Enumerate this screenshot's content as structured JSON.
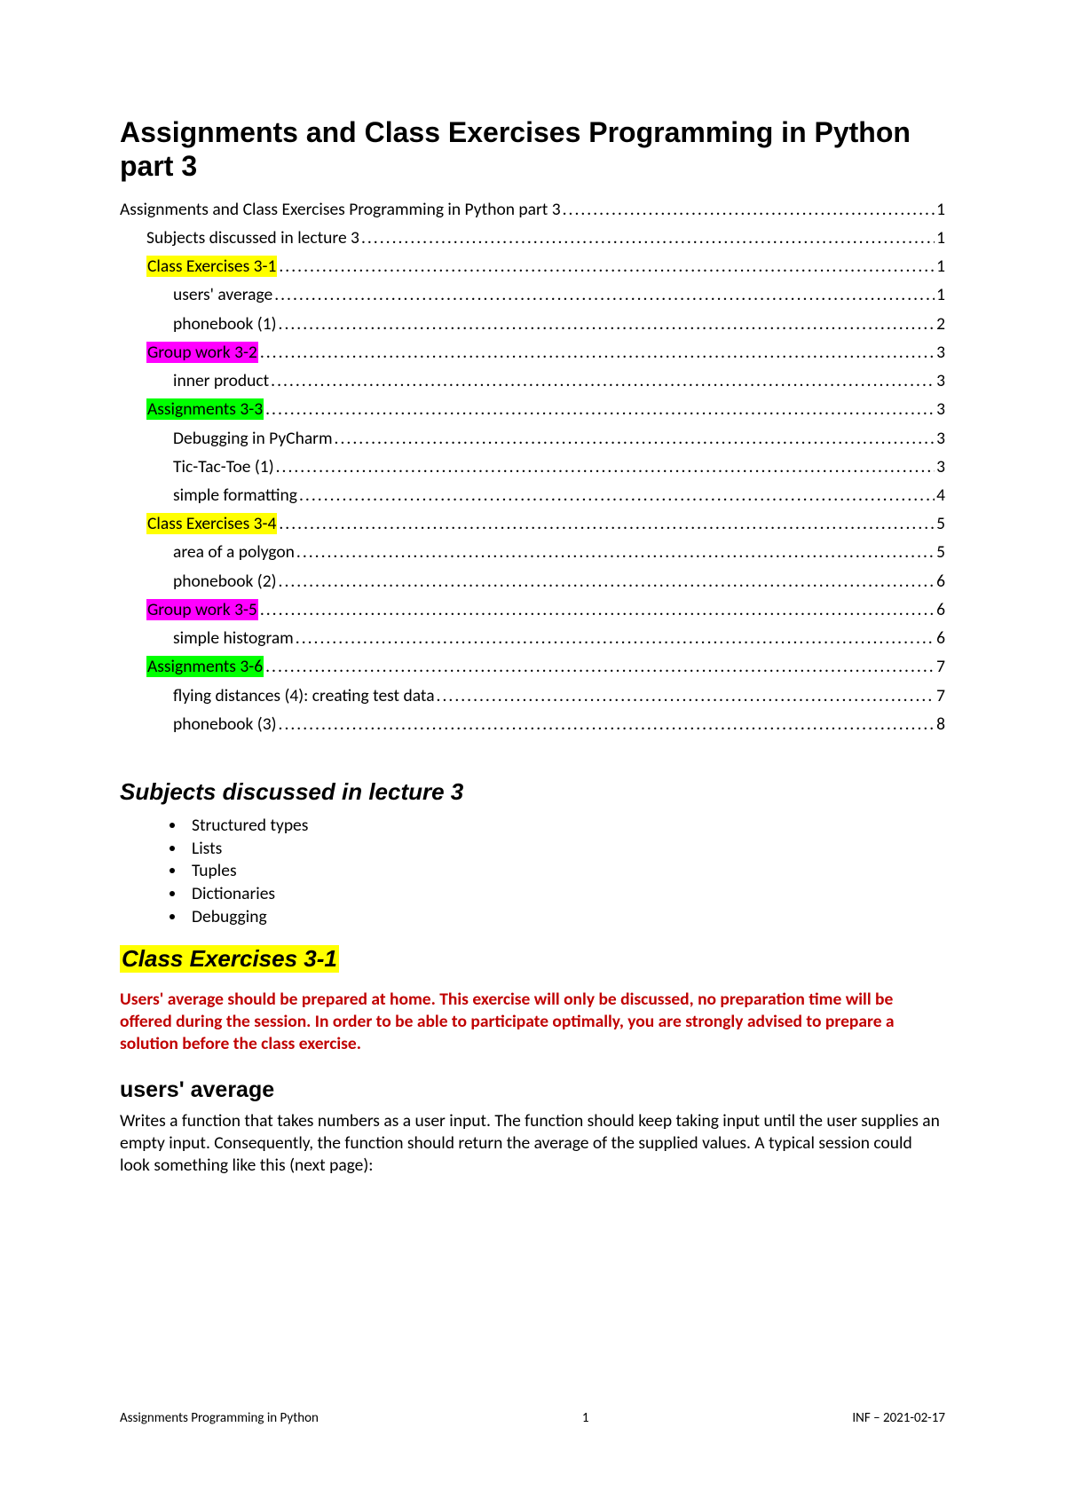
{
  "title": "Assignments and Class Exercises Programming in Python part 3",
  "toc": [
    {
      "label": "Assignments and Class Exercises Programming in Python part 3",
      "page": "1",
      "level": 0,
      "highlight": null
    },
    {
      "label": "Subjects discussed in lecture 3",
      "page": "1",
      "level": 1,
      "highlight": null
    },
    {
      "label": "Class Exercises 3-1",
      "page": "1",
      "level": 1,
      "highlight": "yellow"
    },
    {
      "label": "users' average",
      "page": "1",
      "level": 2,
      "highlight": null
    },
    {
      "label": "phonebook (1)",
      "page": "2",
      "level": 2,
      "highlight": null
    },
    {
      "label": "Group work 3-2",
      "page": "3",
      "level": 1,
      "highlight": "magenta"
    },
    {
      "label": "inner product",
      "page": "3",
      "level": 2,
      "highlight": null
    },
    {
      "label": "Assignments 3-3",
      "page": "3",
      "level": 1,
      "highlight": "green"
    },
    {
      "label": "Debugging in PyCharm",
      "page": "3",
      "level": 2,
      "highlight": null
    },
    {
      "label": "Tic-Tac-Toe (1)",
      "page": "3",
      "level": 2,
      "highlight": null
    },
    {
      "label": "simple formatting",
      "page": "4",
      "level": 2,
      "highlight": null
    },
    {
      "label": "Class Exercises 3-4",
      "page": "5",
      "level": 1,
      "highlight": "yellow"
    },
    {
      "label": "area of a polygon",
      "page": "5",
      "level": 2,
      "highlight": null
    },
    {
      "label": "phonebook (2)",
      "page": "6",
      "level": 2,
      "highlight": null
    },
    {
      "label": "Group work 3-5",
      "page": "6",
      "level": 1,
      "highlight": "magenta"
    },
    {
      "label": "simple histogram",
      "page": "6",
      "level": 2,
      "highlight": null
    },
    {
      "label": "Assignments 3-6",
      "page": "7",
      "level": 1,
      "highlight": "green"
    },
    {
      "label": "flying distances (4): creating test data",
      "page": "7",
      "level": 2,
      "highlight": null
    },
    {
      "label": "phonebook (3)",
      "page": "8",
      "level": 2,
      "highlight": null
    }
  ],
  "sections": {
    "subjects_heading": "Subjects discussed in lecture 3",
    "subjects": [
      "Structured types",
      "Lists",
      "Tuples",
      "Dictionaries",
      "Debugging"
    ],
    "ce31_heading": "Class Exercises 3-1",
    "ce31_note": "Users' average should be prepared at home. This exercise will only be discussed, no preparation time will be offered during the session. In order to be able to participate optimally, you are strongly advised to prepare a solution before the class exercise.",
    "users_avg_heading": "users' average",
    "users_avg_body": "Writes a function that takes numbers as a user input. The function should keep taking input until the user supplies an empty input. Consequently, the function should return the average of the supplied values. A typical session could look something like this (next page):"
  },
  "footer": {
    "left": "Assignments Programming in Python",
    "center": "1",
    "right": "INF – 2021-02-17"
  }
}
